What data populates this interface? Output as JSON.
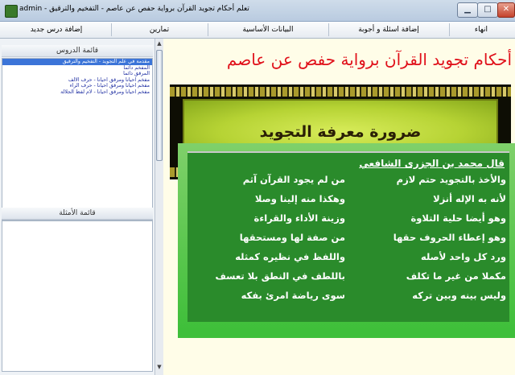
{
  "window": {
    "title": "admin - تعلم أحكام تجويد القرآن برواية حفص عن عاصم - التفخيم والترقيق"
  },
  "menu": {
    "items": [
      "انهاء",
      "إضافة اسئلة و أجوبة",
      "البيانات الأساسية",
      "تمارين",
      "إضافة درس جديد"
    ]
  },
  "sidebar": {
    "lessons_header": "قائمة الدروس",
    "lessons": [
      "مقدمة في علم التجويد - التفخيم والترقيق",
      "المفخم دائما",
      "المرقق دائما",
      "مفخم أحيانا ومرقق أحيانا - حرف الألف",
      "مفخم أحيانا ومرقق أحيانا - حرف الراء",
      "مفخم أحيانا ومرقق أحيانا - لام لفظ الجلالة"
    ],
    "examples_header": "قائمة الأمثلة"
  },
  "content": {
    "page_title": "أحكام تجويد القرآن برواية حفص عن عاصم",
    "banner_title": "ضرورة معرفة التجويد",
    "poem_heading": "قال محمد بن الجزرى الشافعي",
    "verses": [
      {
        "right": "والأخذ بالتجويد حتم لازم",
        "left": "من لم يجود القرآن آثم"
      },
      {
        "right": "لأنه به الإله أنزلا",
        "left": "وهكذا منه إلينا وصلا"
      },
      {
        "right": "وهو أيضا حلية التلاوة",
        "left": "وزينة الأداء والقراءة"
      },
      {
        "right": "وهو إعطاء الحروف حقها",
        "left": "من صفة لها ومستحقها"
      },
      {
        "right": "ورد كل واحد لأصله",
        "left": "واللفظ في نظيره كمثله"
      },
      {
        "right": "مكملا من غير ما تكلف",
        "left": "باللطف في النطق بلا تعسف"
      },
      {
        "right": "وليس بينه وبين تركه",
        "left": "سوى رياضة امرئ بفكه"
      }
    ]
  },
  "colors": {
    "title_red": "#e0101a",
    "panel_green": "#2a8b2b",
    "selection_blue": "#3b74d8"
  }
}
